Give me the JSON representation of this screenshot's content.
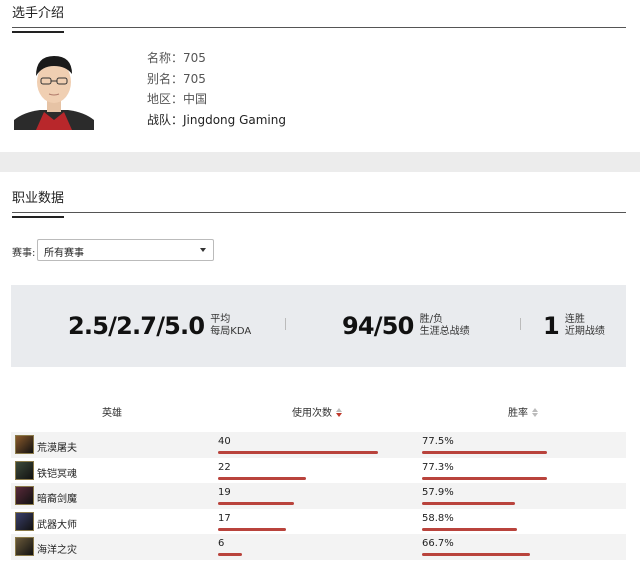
{
  "profile": {
    "section_title": "选手介绍",
    "name_row": "名称：705",
    "alias_row": "别名：705",
    "region_row": "地区：中国",
    "team_row": "战队：Jingdong Gaming"
  },
  "career": {
    "section_title": "职业数据",
    "filter_label": "赛事:",
    "filter_value": "所有赛事",
    "kda": {
      "value": "2.5/2.7/5.0",
      "label1": "平均",
      "label2": "每局KDA"
    },
    "winloss": {
      "value": "94/50",
      "label1": "胜/负",
      "label2": "生涯总战绩"
    },
    "streak": {
      "value": "1",
      "label1": "连胜",
      "label2": "近期战绩"
    }
  },
  "table": {
    "col_hero": "英雄",
    "col_uses": "使用次数",
    "col_rate": "胜率",
    "rows": [
      {
        "hero": "荒漠屠夫",
        "uses": "40",
        "rate": "77.5%",
        "uses_num": 40,
        "rate_num": 77.5,
        "icon_color": "#8a5a2b"
      },
      {
        "hero": "铁铠冥魂",
        "uses": "22",
        "rate": "77.3%",
        "uses_num": 22,
        "rate_num": 77.3,
        "icon_color": "#3d4a3a"
      },
      {
        "hero": "暗裔剑魔",
        "uses": "19",
        "rate": "57.9%",
        "uses_num": 19,
        "rate_num": 57.9,
        "icon_color": "#5a2a3a"
      },
      {
        "hero": "武器大师",
        "uses": "17",
        "rate": "58.8%",
        "uses_num": 17,
        "rate_num": 58.8,
        "icon_color": "#3a3f6a"
      },
      {
        "hero": "海洋之灾",
        "uses": "6",
        "rate": "66.7%",
        "uses_num": 6,
        "rate_num": 66.7,
        "icon_color": "#6a5a3a"
      }
    ]
  },
  "colors": {
    "bar": "#b9433c",
    "stats_bg": "#e9ebee",
    "band": "#ececec"
  }
}
